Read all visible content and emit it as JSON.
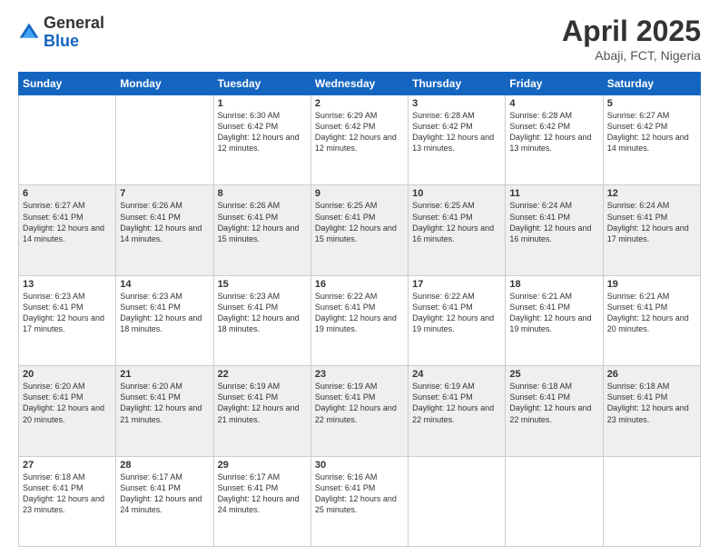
{
  "header": {
    "logo_general": "General",
    "logo_blue": "Blue",
    "month_title": "April 2025",
    "location": "Abaji, FCT, Nigeria"
  },
  "days_of_week": [
    "Sunday",
    "Monday",
    "Tuesday",
    "Wednesday",
    "Thursday",
    "Friday",
    "Saturday"
  ],
  "weeks": [
    [
      {
        "day": "",
        "info": ""
      },
      {
        "day": "",
        "info": ""
      },
      {
        "day": "1",
        "info": "Sunrise: 6:30 AM\nSunset: 6:42 PM\nDaylight: 12 hours and 12 minutes."
      },
      {
        "day": "2",
        "info": "Sunrise: 6:29 AM\nSunset: 6:42 PM\nDaylight: 12 hours and 12 minutes."
      },
      {
        "day": "3",
        "info": "Sunrise: 6:28 AM\nSunset: 6:42 PM\nDaylight: 12 hours and 13 minutes."
      },
      {
        "day": "4",
        "info": "Sunrise: 6:28 AM\nSunset: 6:42 PM\nDaylight: 12 hours and 13 minutes."
      },
      {
        "day": "5",
        "info": "Sunrise: 6:27 AM\nSunset: 6:42 PM\nDaylight: 12 hours and 14 minutes."
      }
    ],
    [
      {
        "day": "6",
        "info": "Sunrise: 6:27 AM\nSunset: 6:41 PM\nDaylight: 12 hours and 14 minutes."
      },
      {
        "day": "7",
        "info": "Sunrise: 6:26 AM\nSunset: 6:41 PM\nDaylight: 12 hours and 14 minutes."
      },
      {
        "day": "8",
        "info": "Sunrise: 6:26 AM\nSunset: 6:41 PM\nDaylight: 12 hours and 15 minutes."
      },
      {
        "day": "9",
        "info": "Sunrise: 6:25 AM\nSunset: 6:41 PM\nDaylight: 12 hours and 15 minutes."
      },
      {
        "day": "10",
        "info": "Sunrise: 6:25 AM\nSunset: 6:41 PM\nDaylight: 12 hours and 16 minutes."
      },
      {
        "day": "11",
        "info": "Sunrise: 6:24 AM\nSunset: 6:41 PM\nDaylight: 12 hours and 16 minutes."
      },
      {
        "day": "12",
        "info": "Sunrise: 6:24 AM\nSunset: 6:41 PM\nDaylight: 12 hours and 17 minutes."
      }
    ],
    [
      {
        "day": "13",
        "info": "Sunrise: 6:23 AM\nSunset: 6:41 PM\nDaylight: 12 hours and 17 minutes."
      },
      {
        "day": "14",
        "info": "Sunrise: 6:23 AM\nSunset: 6:41 PM\nDaylight: 12 hours and 18 minutes."
      },
      {
        "day": "15",
        "info": "Sunrise: 6:23 AM\nSunset: 6:41 PM\nDaylight: 12 hours and 18 minutes."
      },
      {
        "day": "16",
        "info": "Sunrise: 6:22 AM\nSunset: 6:41 PM\nDaylight: 12 hours and 19 minutes."
      },
      {
        "day": "17",
        "info": "Sunrise: 6:22 AM\nSunset: 6:41 PM\nDaylight: 12 hours and 19 minutes."
      },
      {
        "day": "18",
        "info": "Sunrise: 6:21 AM\nSunset: 6:41 PM\nDaylight: 12 hours and 19 minutes."
      },
      {
        "day": "19",
        "info": "Sunrise: 6:21 AM\nSunset: 6:41 PM\nDaylight: 12 hours and 20 minutes."
      }
    ],
    [
      {
        "day": "20",
        "info": "Sunrise: 6:20 AM\nSunset: 6:41 PM\nDaylight: 12 hours and 20 minutes."
      },
      {
        "day": "21",
        "info": "Sunrise: 6:20 AM\nSunset: 6:41 PM\nDaylight: 12 hours and 21 minutes."
      },
      {
        "day": "22",
        "info": "Sunrise: 6:19 AM\nSunset: 6:41 PM\nDaylight: 12 hours and 21 minutes."
      },
      {
        "day": "23",
        "info": "Sunrise: 6:19 AM\nSunset: 6:41 PM\nDaylight: 12 hours and 22 minutes."
      },
      {
        "day": "24",
        "info": "Sunrise: 6:19 AM\nSunset: 6:41 PM\nDaylight: 12 hours and 22 minutes."
      },
      {
        "day": "25",
        "info": "Sunrise: 6:18 AM\nSunset: 6:41 PM\nDaylight: 12 hours and 22 minutes."
      },
      {
        "day": "26",
        "info": "Sunrise: 6:18 AM\nSunset: 6:41 PM\nDaylight: 12 hours and 23 minutes."
      }
    ],
    [
      {
        "day": "27",
        "info": "Sunrise: 6:18 AM\nSunset: 6:41 PM\nDaylight: 12 hours and 23 minutes."
      },
      {
        "day": "28",
        "info": "Sunrise: 6:17 AM\nSunset: 6:41 PM\nDaylight: 12 hours and 24 minutes."
      },
      {
        "day": "29",
        "info": "Sunrise: 6:17 AM\nSunset: 6:41 PM\nDaylight: 12 hours and 24 minutes."
      },
      {
        "day": "30",
        "info": "Sunrise: 6:16 AM\nSunset: 6:41 PM\nDaylight: 12 hours and 25 minutes."
      },
      {
        "day": "",
        "info": ""
      },
      {
        "day": "",
        "info": ""
      },
      {
        "day": "",
        "info": ""
      }
    ]
  ]
}
